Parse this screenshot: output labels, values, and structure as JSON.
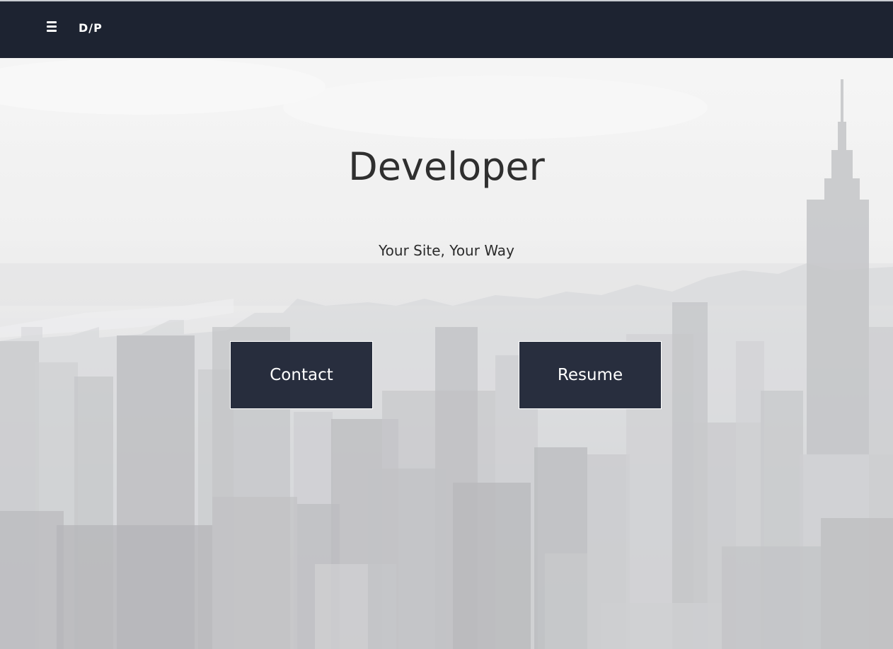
{
  "nav": {
    "menu_icon": "hamburger-menu-icon",
    "brand": "D/P",
    "background": "#1d2331"
  },
  "hero": {
    "background_image": "grayscale city skyline",
    "title": "Developer",
    "subtitle": "Your Site, Your Way",
    "buttons": {
      "contact": "Contact",
      "resume": "Resume"
    },
    "button_color": "#1d2334"
  }
}
